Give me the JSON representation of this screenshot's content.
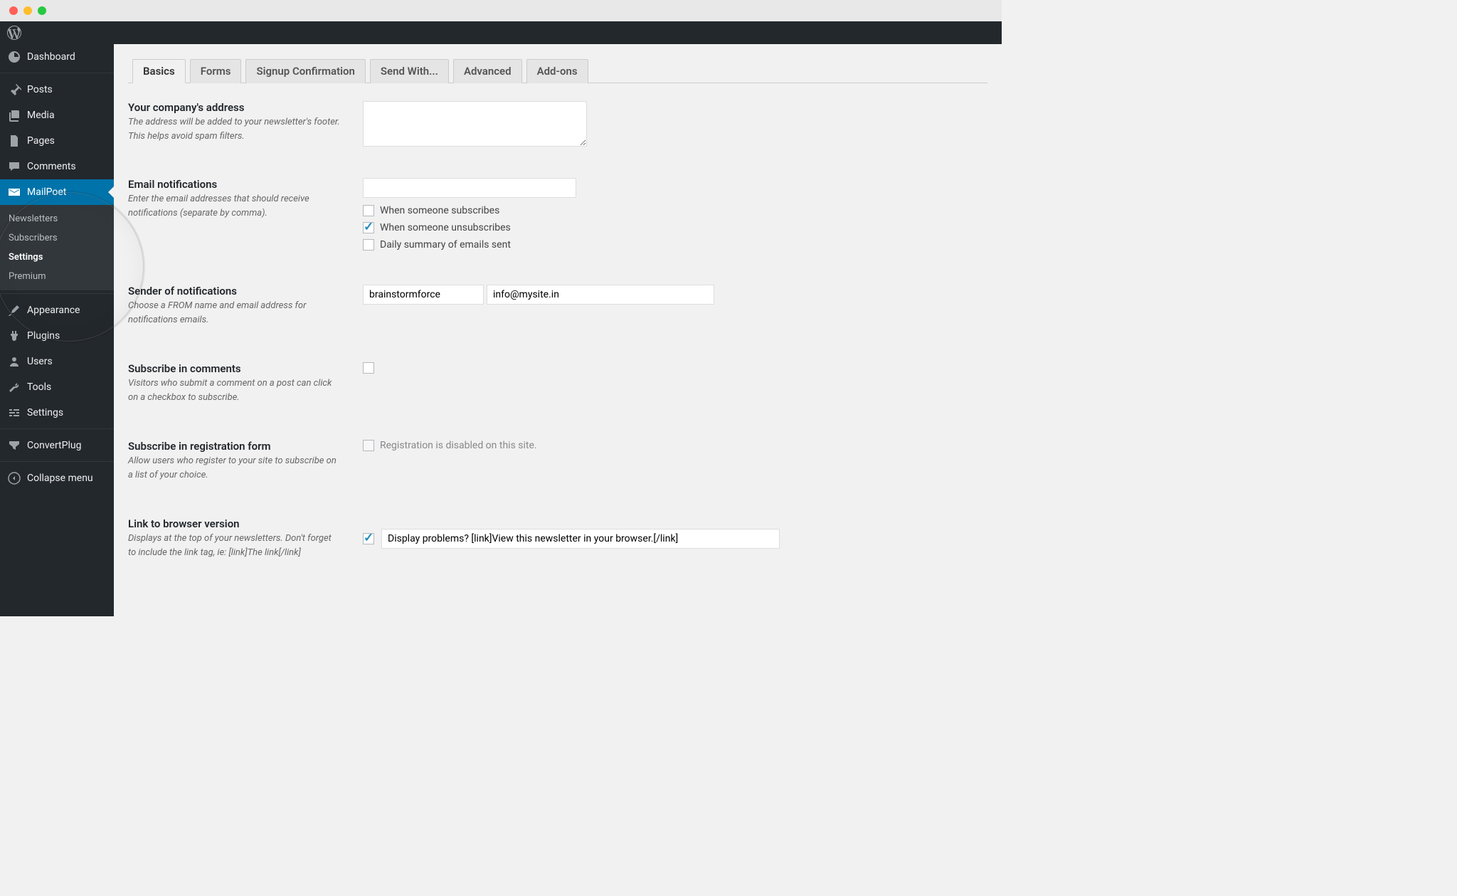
{
  "sidebar": {
    "items": [
      {
        "label": "Dashboard"
      },
      {
        "label": "Posts"
      },
      {
        "label": "Media"
      },
      {
        "label": "Pages"
      },
      {
        "label": "Comments"
      },
      {
        "label": "MailPoet"
      },
      {
        "label": "Appearance"
      },
      {
        "label": "Plugins"
      },
      {
        "label": "Users"
      },
      {
        "label": "Tools"
      },
      {
        "label": "Settings"
      },
      {
        "label": "ConvertPlug"
      },
      {
        "label": "Collapse menu"
      }
    ],
    "submenu": [
      {
        "label": "Newsletters"
      },
      {
        "label": "Subscribers"
      },
      {
        "label": "Settings"
      },
      {
        "label": "Premium"
      }
    ]
  },
  "tabs": [
    {
      "label": "Basics"
    },
    {
      "label": "Forms"
    },
    {
      "label": "Signup Confirmation"
    },
    {
      "label": "Send With..."
    },
    {
      "label": "Advanced"
    },
    {
      "label": "Add-ons"
    }
  ],
  "fields": {
    "company_address": {
      "title": "Your company's address",
      "desc": "The address will be added to your newsletter's footer. This helps avoid spam filters.",
      "value": ""
    },
    "email_notifications": {
      "title": "Email notifications",
      "desc": "Enter the email addresses that should receive notifications (separate by comma).",
      "value": "",
      "checkboxes": {
        "subscribe": {
          "label": "When someone subscribes",
          "checked": false
        },
        "unsubscribe": {
          "label": "When someone unsubscribes",
          "checked": true
        },
        "daily": {
          "label": "Daily summary of emails sent",
          "checked": false
        }
      }
    },
    "sender": {
      "title": "Sender of notifications",
      "desc": "Choose a FROM name and email address for notifications emails.",
      "name": "brainstormforce",
      "email": "info@mysite.in"
    },
    "subscribe_comments": {
      "title": "Subscribe in comments",
      "desc": "Visitors who submit a comment on a post can click on a checkbox to subscribe.",
      "checked": false
    },
    "subscribe_registration": {
      "title": "Subscribe in registration form",
      "desc": "Allow users who register to your site to subscribe on a list of your choice.",
      "disabled_text": "Registration is disabled on this site."
    },
    "browser_link": {
      "title": "Link to browser version",
      "desc": "Displays at the top of your newsletters. Don't forget to include the link tag, ie: [link]The link[/link]",
      "checked": true,
      "value": "Display problems? [link]View this newsletter in your browser.[/link]"
    }
  }
}
